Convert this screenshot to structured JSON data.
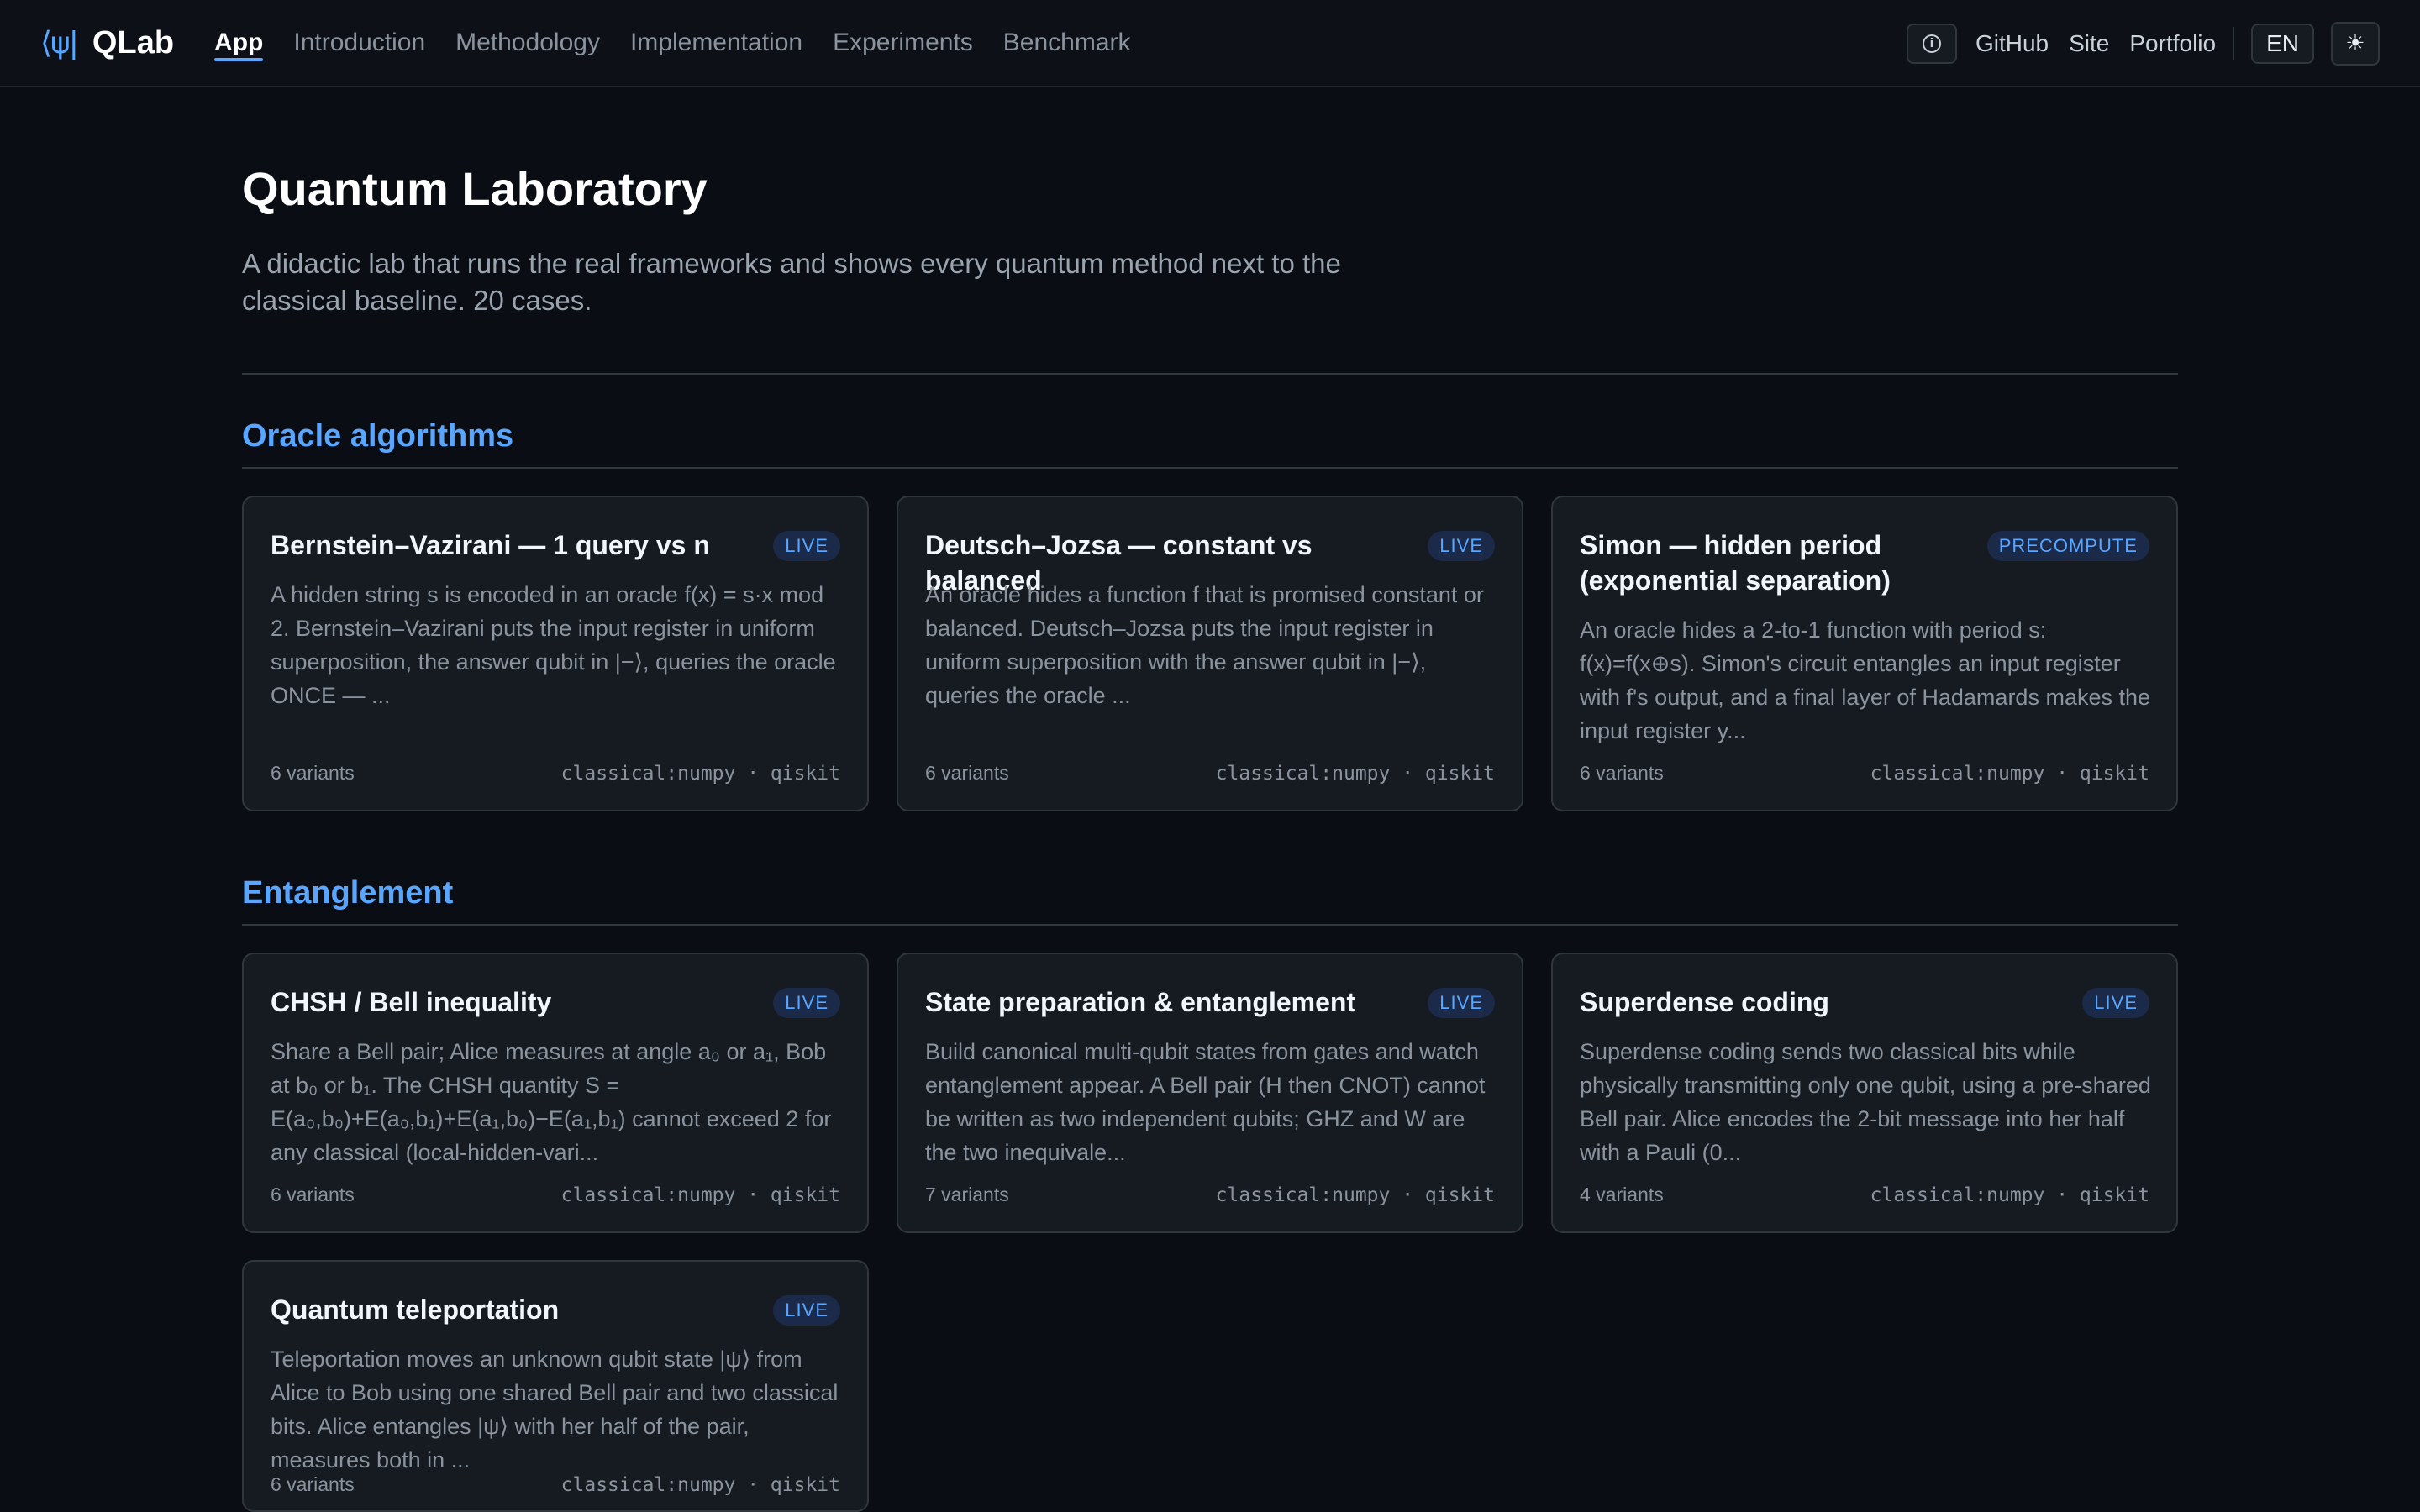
{
  "nav": {
    "logo_glyph": "⟨ψ|",
    "brand": "QLab",
    "items": [
      {
        "label": "App",
        "active": true
      },
      {
        "label": "Introduction"
      },
      {
        "label": "Methodology"
      },
      {
        "label": "Implementation"
      },
      {
        "label": "Experiments"
      },
      {
        "label": "Benchmark"
      }
    ],
    "info_icon": "info-icon",
    "links": [
      "GitHub",
      "Site",
      "Portfolio"
    ],
    "lang": "EN",
    "theme_glyph": "☀",
    "accent_color": "#58a6ff"
  },
  "page": {
    "title": "Quantum Laboratory",
    "description": "A didactic lab that runs the real frameworks and shows every quantum method next to the classical baseline. 20 cases."
  },
  "sections": [
    {
      "title": "Oracle algorithms",
      "cards": [
        {
          "title": "Bernstein–Vazirani — 1 query vs n",
          "badge": "LIVE",
          "description": "A hidden string s is encoded in an oracle f(x) = s·x mod 2. Bernstein–Vazirani puts the input register in uniform superposition, the answer qubit in |−⟩, queries the oracle ONCE — ...",
          "variants": "6 variants",
          "frameworks": "classical:numpy · qiskit"
        },
        {
          "title": "Deutsch–Jozsa — constant vs balanced",
          "badge": "LIVE",
          "description": "An oracle hides a function f that is promised constant or balanced. Deutsch–Jozsa puts the input register in uniform superposition with the answer qubit in |−⟩, queries the oracle ...",
          "variants": "6 variants",
          "frameworks": "classical:numpy · qiskit"
        },
        {
          "title": "Simon — hidden period (exponential separation)",
          "badge": "PRECOMPUTE",
          "description": "An oracle hides a 2-to-1 function with period s: f(x)=f(x⊕s). Simon's circuit entangles an input register with f's output, and a final layer of Hadamards makes the input register y...",
          "variants": "6 variants",
          "frameworks": "classical:numpy · qiskit"
        }
      ]
    },
    {
      "title": "Entanglement",
      "cards": [
        {
          "title": "CHSH / Bell inequality",
          "badge": "LIVE",
          "description": "Share a Bell pair; Alice measures at angle a₀ or a₁, Bob at b₀ or b₁. The CHSH quantity S = E(a₀,b₀)+E(a₀,b₁)+E(a₁,b₀)−E(a₁,b₁) cannot exceed 2 for any classical (local-hidden-vari...",
          "variants": "6 variants",
          "frameworks": "classical:numpy · qiskit"
        },
        {
          "title": "State preparation & entanglement",
          "badge": "LIVE",
          "description": "Build canonical multi-qubit states from gates and watch entanglement appear. A Bell pair (H then CNOT) cannot be written as two independent qubits; GHZ and W are the two inequivale...",
          "variants": "7 variants",
          "frameworks": "classical:numpy · qiskit"
        },
        {
          "title": "Superdense coding",
          "badge": "LIVE",
          "description": "Superdense coding sends two classical bits while physically transmitting only one qubit, using a pre-shared Bell pair. Alice encodes the 2-bit message into her half with a Pauli (0...",
          "variants": "4 variants",
          "frameworks": "classical:numpy · qiskit"
        },
        {
          "title": "Quantum teleportation",
          "badge": "LIVE",
          "description": "Teleportation moves an unknown qubit state |ψ⟩ from Alice to Bob using one shared Bell pair and two classical bits. Alice entangles |ψ⟩ with her half of the pair, measures both in ...",
          "variants": "6 variants",
          "frameworks": "classical:numpy · qiskit"
        }
      ]
    }
  ]
}
